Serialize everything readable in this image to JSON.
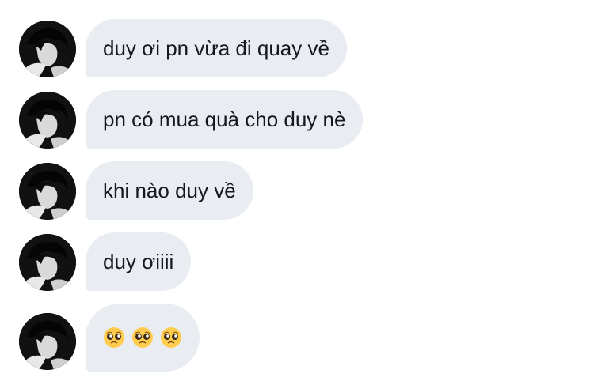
{
  "messages": [
    {
      "text": "duy ơi pn vừa đi quay về"
    },
    {
      "text": "pn có mua quà cho duy nè"
    },
    {
      "text": "khi nào duy về"
    },
    {
      "text": "duy ơiiii"
    },
    {
      "emojis": [
        "pleading-face",
        "pleading-face",
        "pleading-face"
      ]
    }
  ],
  "colors": {
    "bubble_bg": "#e9edf1",
    "text": "#15191e",
    "avatar_bg": "#0f0f0f",
    "emoji_face": "#ffcc4d"
  }
}
